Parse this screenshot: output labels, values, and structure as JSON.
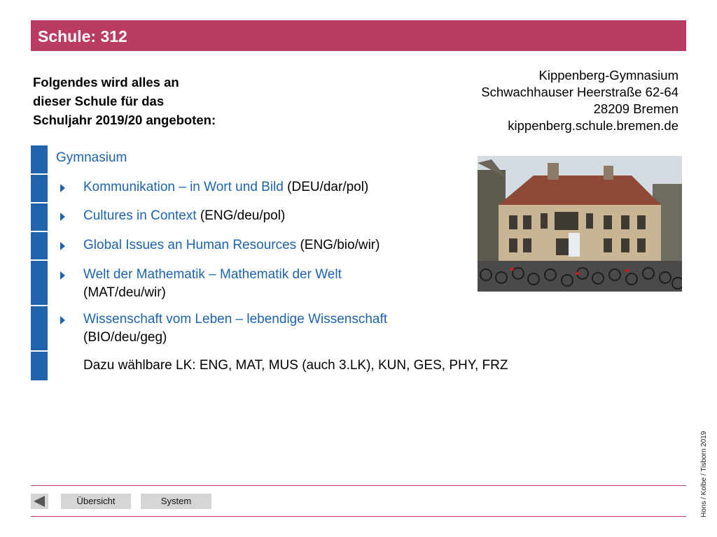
{
  "header": {
    "title": "Schule: 312"
  },
  "intro": {
    "lines": [
      "Folgendes wird alles an",
      "dieser Schule für das",
      "Schuljahr 2019/20 angeboten:"
    ]
  },
  "address": {
    "lines": [
      "Kippenberg-Gymnasium",
      "Schwachhauser Heerstraße 62-64",
      "28209 Bremen",
      "kippenberg.schule.bremen.de"
    ]
  },
  "courses": {
    "heading": "Gymnasium",
    "items": [
      {
        "name": "Kommunikation – in Wort und Bild",
        "subjects": "(DEU/dar/pol)"
      },
      {
        "name": "Cultures in Context",
        "subjects": "(ENG/deu/pol)"
      },
      {
        "name": "Global Issues an Human Resources",
        "subjects": "(ENG/bio/wir)"
      },
      {
        "name": "Welt der Mathematik – Mathematik der Welt",
        "subjects": "(MAT/deu/wir)"
      },
      {
        "name": "Wissenschaft vom Leben – lebendige Wissenschaft",
        "subjects": "(BIO/deu/geg)"
      }
    ],
    "electives": "Dazu wählbare LK: ENG, MAT, MUS (auch 3.LK), KUN, GES, PHY, FRZ"
  },
  "credit": "Hons / Kolbe / Tisborn 2019",
  "footer": {
    "overview_label": "Übersicht",
    "system_label": "System"
  },
  "colors": {
    "header": "#ba3c63",
    "accent": "#1f63ad"
  }
}
